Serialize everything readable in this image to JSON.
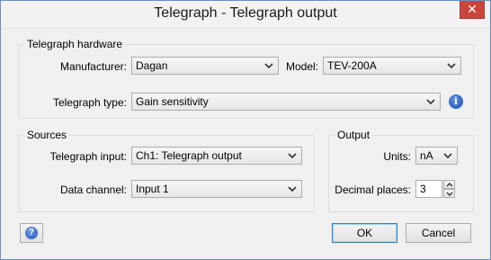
{
  "window": {
    "title": "Telegraph - Telegraph output",
    "close_glyph": "✕"
  },
  "hardware": {
    "group_label": "Telegraph hardware",
    "manufacturer_label": "Manufacturer:",
    "manufacturer_value": "Dagan",
    "model_label": "Model:",
    "model_value": "TEV-200A",
    "type_label": "Telegraph type:",
    "type_value": "Gain sensitivity",
    "info_glyph": "i"
  },
  "sources": {
    "group_label": "Sources",
    "input_label": "Telegraph input:",
    "input_value": "Ch1: Telegraph output",
    "channel_label": "Data channel:",
    "channel_value": "Input 1"
  },
  "output": {
    "group_label": "Output",
    "units_label": "Units:",
    "units_value": "nA",
    "decimals_label": "Decimal places:",
    "decimals_value": "3"
  },
  "buttons": {
    "help_glyph": "?",
    "ok_label": "OK",
    "cancel_label": "Cancel"
  },
  "icons": {
    "close": "close-icon",
    "dropdown": "chevron-down-icon",
    "info": "info-icon",
    "help": "help-icon",
    "spin_up": "chevron-up-icon",
    "spin_down": "chevron-down-icon"
  },
  "colors": {
    "close_button": "#c9463d",
    "info_icon": "#1c4fb0",
    "default_button_border": "#3c7fb1"
  }
}
